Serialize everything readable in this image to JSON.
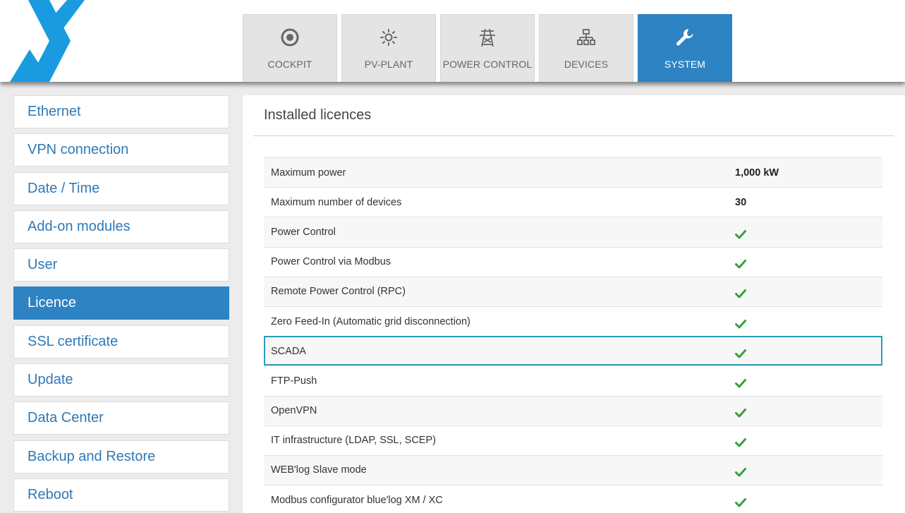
{
  "colors": {
    "accent": "#2e83c3",
    "check": "#3a9e3a",
    "logo": "#1a9be0"
  },
  "nav": {
    "tabs": [
      {
        "label": "COCKPIT",
        "icon": "target-icon"
      },
      {
        "label": "PV-PLANT",
        "icon": "sun-icon"
      },
      {
        "label": "POWER CONTROL",
        "icon": "power-tower-icon"
      },
      {
        "label": "DEVICES",
        "icon": "network-icon"
      },
      {
        "label": "SYSTEM",
        "icon": "wrench-icon",
        "active": true
      }
    ]
  },
  "sidebar": {
    "items": [
      {
        "label": "Ethernet"
      },
      {
        "label": "VPN connection"
      },
      {
        "label": "Date / Time"
      },
      {
        "label": "Add-on modules"
      },
      {
        "label": "User"
      },
      {
        "label": "Licence",
        "active": true
      },
      {
        "label": "SSL certificate"
      },
      {
        "label": "Update"
      },
      {
        "label": "Data Center"
      },
      {
        "label": "Backup and Restore"
      },
      {
        "label": "Reboot"
      }
    ]
  },
  "main": {
    "title": "Installed licences",
    "rows": [
      {
        "name": "Maximum power",
        "value": "1,000 kW"
      },
      {
        "name": "Maximum number of devices",
        "value": "30"
      },
      {
        "name": "Power Control",
        "value": "check-icon"
      },
      {
        "name": "Power Control via Modbus",
        "value": "check-icon"
      },
      {
        "name": "Remote Power Control (RPC)",
        "value": "check-icon"
      },
      {
        "name": "Zero Feed-In (Automatic grid disconnection)",
        "value": "check-icon"
      },
      {
        "name": "SCADA",
        "value": "check-icon",
        "selected": true
      },
      {
        "name": "FTP-Push",
        "value": "check-icon"
      },
      {
        "name": "OpenVPN",
        "value": "check-icon"
      },
      {
        "name": "IT infrastructure (LDAP, SSL, SCEP)",
        "value": "check-icon"
      },
      {
        "name": "WEB'log Slave mode",
        "value": "check-icon"
      },
      {
        "name": "Modbus configurator blue'log XM / XC",
        "value": "check-icon"
      }
    ]
  }
}
